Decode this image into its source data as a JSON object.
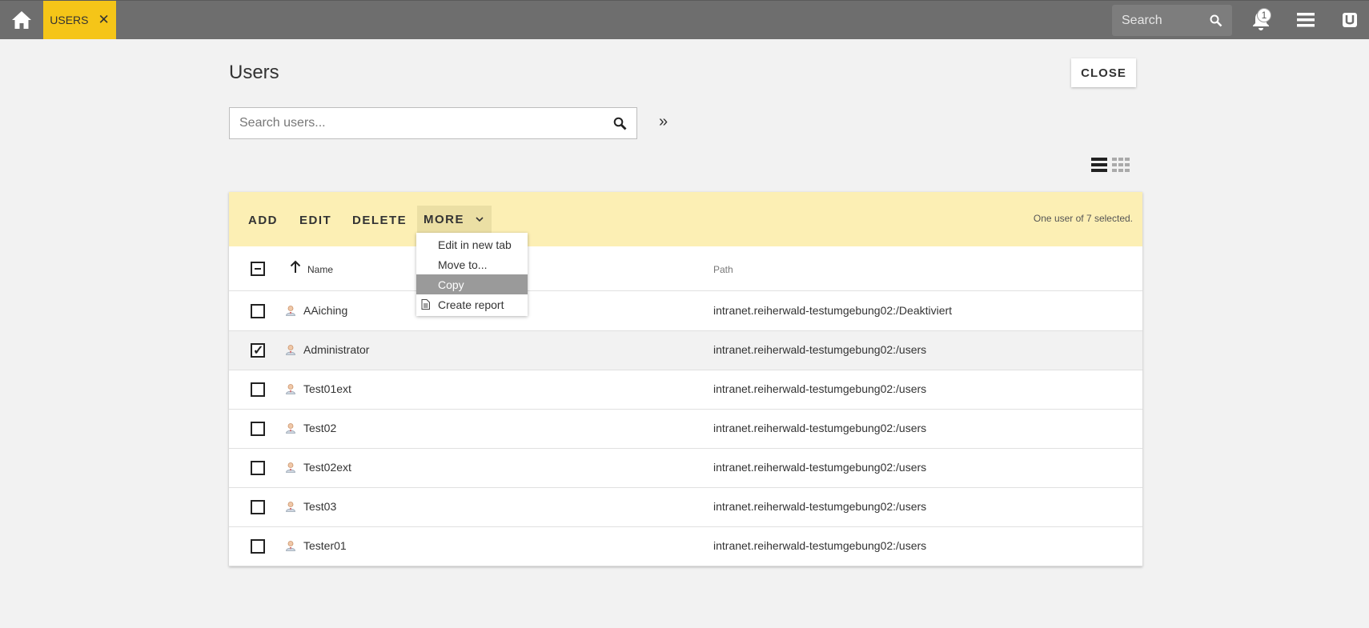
{
  "topbar": {
    "tab_label": "USERS",
    "search_placeholder": "Search",
    "notification_count": "1"
  },
  "page": {
    "title": "Users",
    "close_label": "CLOSE",
    "search_placeholder": "Search users...",
    "expand_label": "»"
  },
  "toolbar": {
    "add_label": "ADD",
    "edit_label": "EDIT",
    "delete_label": "DELETE",
    "more_label": "MORE",
    "selection_info": "One user of 7 selected."
  },
  "table": {
    "columns": {
      "name": "Name",
      "path": "Path"
    },
    "rows": [
      {
        "name": "AAiching",
        "path": "intranet.reiherwald-testumgebung02:/Deaktiviert",
        "checked": false
      },
      {
        "name": "Administrator",
        "path": "intranet.reiherwald-testumgebung02:/users",
        "checked": true
      },
      {
        "name": "Test01ext",
        "path": "intranet.reiherwald-testumgebung02:/users",
        "checked": false
      },
      {
        "name": "Test02",
        "path": "intranet.reiherwald-testumgebung02:/users",
        "checked": false
      },
      {
        "name": "Test02ext",
        "path": "intranet.reiherwald-testumgebung02:/users",
        "checked": false
      },
      {
        "name": "Test03",
        "path": "intranet.reiherwald-testumgebung02:/users",
        "checked": false
      },
      {
        "name": "Tester01",
        "path": "intranet.reiherwald-testumgebung02:/users",
        "checked": false
      }
    ]
  },
  "more_menu": {
    "items": [
      {
        "label": "Edit in new tab"
      },
      {
        "label": "Move to..."
      },
      {
        "label": "Copy"
      },
      {
        "label": "Create report"
      }
    ]
  },
  "colors": {
    "topbar": "#6e6e6e",
    "tab_accent": "#f5c518",
    "toolbar_bg": "#fcefb4",
    "menu_highlight": "#9a9a9a"
  }
}
